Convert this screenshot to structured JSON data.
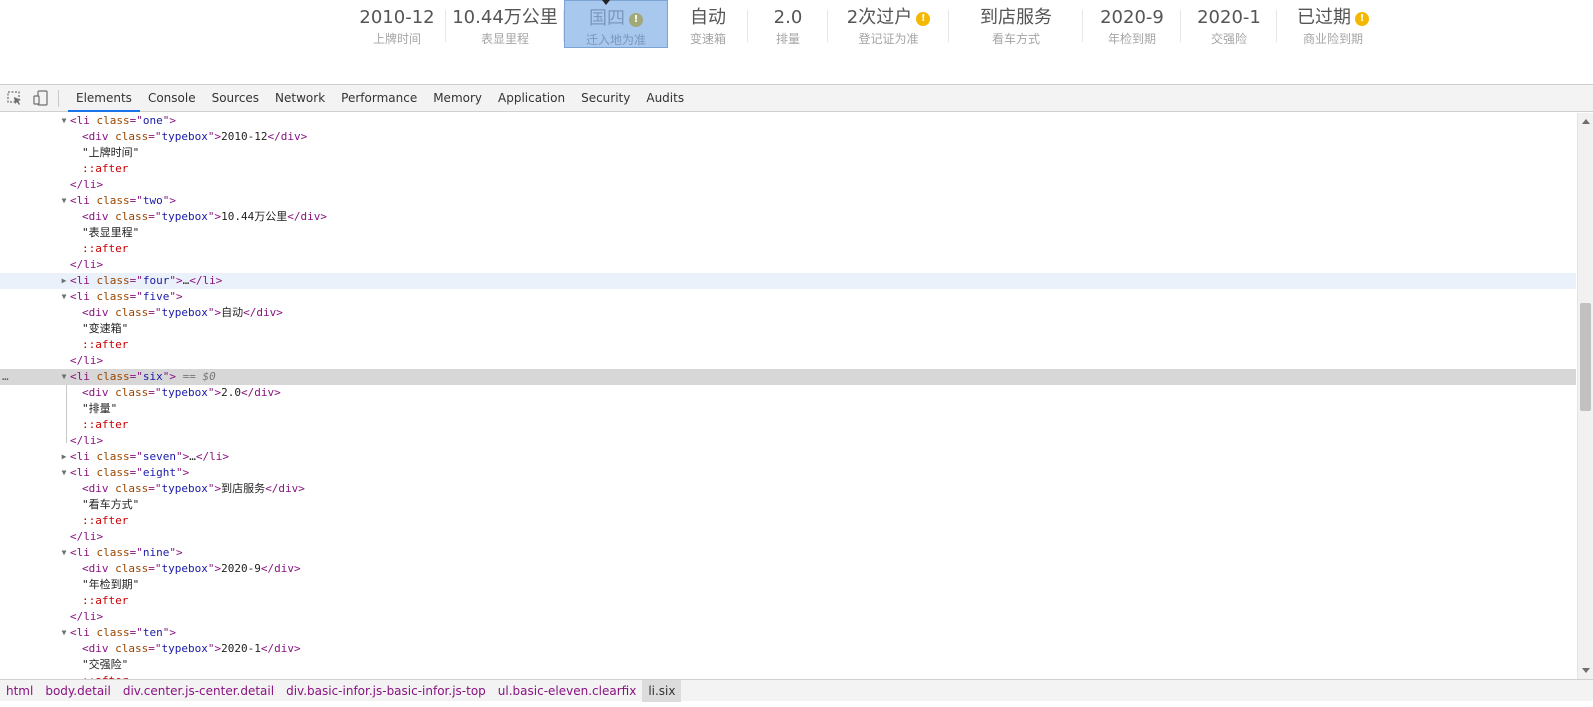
{
  "specs": [
    {
      "value": "2010-12",
      "label": "上牌时间"
    },
    {
      "value": "10.44万公里",
      "label": "表显里程"
    },
    {
      "value": "国四",
      "label": "迁入地为准"
    },
    {
      "value": "自动",
      "label": "变速箱"
    },
    {
      "value": "2.0",
      "label": "排量"
    },
    {
      "value": "2次过户",
      "label": "登记证为准"
    },
    {
      "value": "到店服务",
      "label": "看车方式"
    },
    {
      "value": "2020-9",
      "label": "年检到期"
    },
    {
      "value": "2020-1",
      "label": "交强险"
    },
    {
      "value": "已过期",
      "label": "商业险到期"
    }
  ],
  "devtools": {
    "tabs": [
      "Elements",
      "Console",
      "Sources",
      "Network",
      "Performance",
      "Memory",
      "Application",
      "Security",
      "Audits"
    ],
    "active_tab": "Elements",
    "dom_lines": [
      {
        "indent": 0,
        "arrow": "open",
        "kind": "open",
        "tag": "li",
        "cls": "one"
      },
      {
        "indent": 1,
        "kind": "div",
        "cls": "typebox",
        "text": "2010-12"
      },
      {
        "indent": 1,
        "kind": "text",
        "text": "\"上牌时间\""
      },
      {
        "indent": 1,
        "kind": "pseudo",
        "text": "::after"
      },
      {
        "indent": 0,
        "kind": "close",
        "tag": "li"
      },
      {
        "indent": 0,
        "arrow": "open",
        "kind": "open",
        "tag": "li",
        "cls": "two"
      },
      {
        "indent": 1,
        "kind": "div",
        "cls": "typebox",
        "text": "10.44万公里"
      },
      {
        "indent": 1,
        "kind": "text",
        "text": "\"表显里程\""
      },
      {
        "indent": 1,
        "kind": "pseudo",
        "text": "::after"
      },
      {
        "indent": 0,
        "kind": "close",
        "tag": "li"
      },
      {
        "indent": 0,
        "arrow": "closed",
        "kind": "collapsed",
        "tag": "li",
        "cls": "four",
        "hover": true
      },
      {
        "indent": 0,
        "arrow": "open",
        "kind": "open",
        "tag": "li",
        "cls": "five"
      },
      {
        "indent": 1,
        "kind": "div",
        "cls": "typebox",
        "text": "自动"
      },
      {
        "indent": 1,
        "kind": "text",
        "text": "\"变速箱\""
      },
      {
        "indent": 1,
        "kind": "pseudo",
        "text": "::after"
      },
      {
        "indent": 0,
        "kind": "close",
        "tag": "li"
      },
      {
        "indent": 0,
        "arrow": "open",
        "kind": "open",
        "tag": "li",
        "cls": "six",
        "selected": true,
        "suffix": " == $0"
      },
      {
        "indent": 1,
        "kind": "div",
        "cls": "typebox",
        "text": "2.0"
      },
      {
        "indent": 1,
        "kind": "text",
        "text": "\"排量\""
      },
      {
        "indent": 1,
        "kind": "pseudo",
        "text": "::after"
      },
      {
        "indent": 0,
        "kind": "close",
        "tag": "li"
      },
      {
        "indent": 0,
        "arrow": "closed",
        "kind": "collapsed",
        "tag": "li",
        "cls": "seven"
      },
      {
        "indent": 0,
        "arrow": "open",
        "kind": "open",
        "tag": "li",
        "cls": "eight"
      },
      {
        "indent": 1,
        "kind": "div",
        "cls": "typebox",
        "text": "到店服务"
      },
      {
        "indent": 1,
        "kind": "text",
        "text": "\"看车方式\""
      },
      {
        "indent": 1,
        "kind": "pseudo",
        "text": "::after"
      },
      {
        "indent": 0,
        "kind": "close",
        "tag": "li"
      },
      {
        "indent": 0,
        "arrow": "open",
        "kind": "open",
        "tag": "li",
        "cls": "nine"
      },
      {
        "indent": 1,
        "kind": "div",
        "cls": "typebox",
        "text": "2020-9"
      },
      {
        "indent": 1,
        "kind": "text",
        "text": "\"年检到期\""
      },
      {
        "indent": 1,
        "kind": "pseudo",
        "text": "::after"
      },
      {
        "indent": 0,
        "kind": "close",
        "tag": "li"
      },
      {
        "indent": 0,
        "arrow": "open",
        "kind": "open",
        "tag": "li",
        "cls": "ten"
      },
      {
        "indent": 1,
        "kind": "div",
        "cls": "typebox",
        "text": "2020-1"
      },
      {
        "indent": 1,
        "kind": "text",
        "text": "\"交强险\""
      },
      {
        "indent": 1,
        "kind": "pseudo",
        "text": "::after"
      }
    ],
    "breadcrumbs": [
      "html",
      "body.detail",
      "div.center.js-center.detail",
      "div.basic-infor.js-basic-infor.js-top",
      "ul.basic-eleven.clearfix",
      "li.six"
    ]
  }
}
